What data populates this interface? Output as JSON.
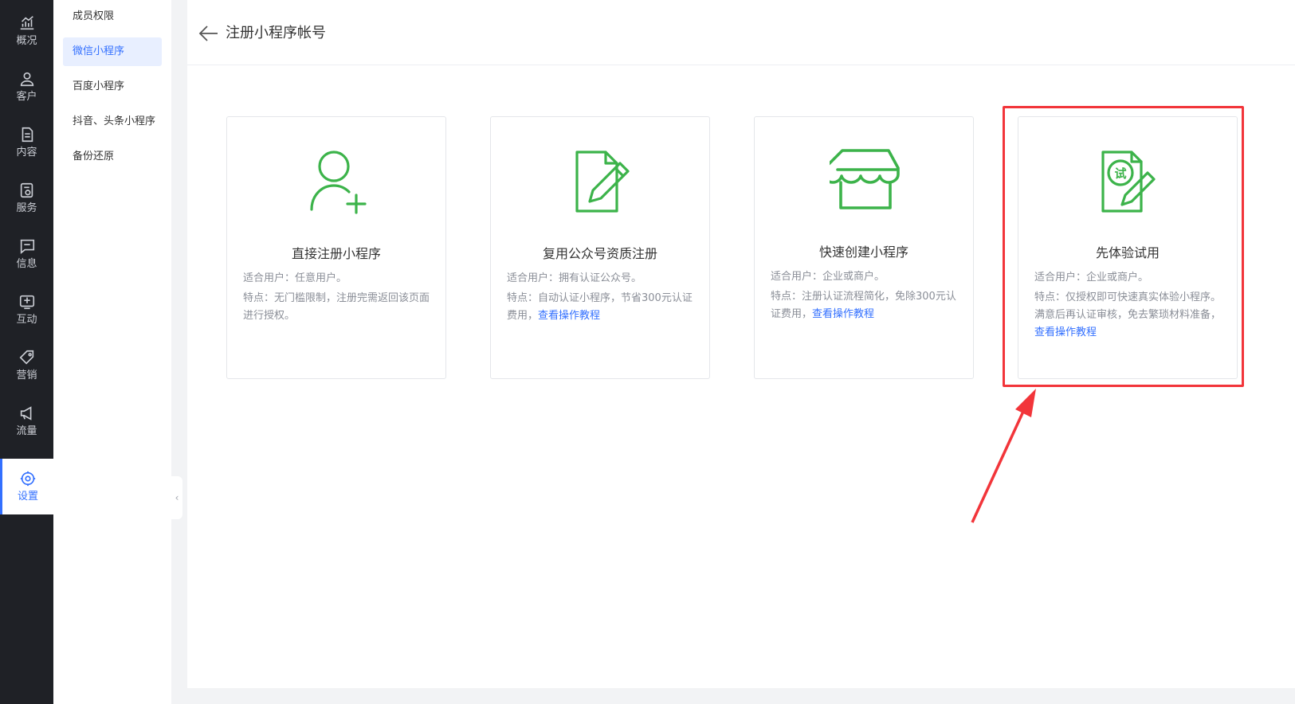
{
  "nav": {
    "items": [
      {
        "label": "概况",
        "icon": "chart-icon"
      },
      {
        "label": "客户",
        "icon": "user-icon"
      },
      {
        "label": "内容",
        "icon": "document-icon"
      },
      {
        "label": "服务",
        "icon": "service-icon"
      },
      {
        "label": "信息",
        "icon": "message-icon"
      },
      {
        "label": "互动",
        "icon": "interact-icon"
      },
      {
        "label": "营销",
        "icon": "tag-icon"
      },
      {
        "label": "流量",
        "icon": "megaphone-icon"
      },
      {
        "label": "设置",
        "icon": "gear-icon",
        "active": true
      }
    ]
  },
  "submenu": {
    "items": [
      {
        "label": "成员权限"
      },
      {
        "label": "微信小程序",
        "active": true
      },
      {
        "label": "百度小程序"
      },
      {
        "label": "抖音、头条小程序"
      },
      {
        "label": "备份还原"
      }
    ]
  },
  "collapse_glyph": "‹",
  "header": {
    "title": "注册小程序帐号"
  },
  "cards": [
    {
      "title": "直接注册小程序",
      "icon": "add-user-icon",
      "line1": "适合用户：任意用户。",
      "line2": "特点：无门槛限制，注册完需返回该页面进行授权。",
      "link": ""
    },
    {
      "title": "复用公众号资质注册",
      "icon": "edit-document-icon",
      "line1": "适合用户：拥有认证公众号。",
      "line2": "特点：自动认证小程序，节省300元认证费用，",
      "link": "查看操作教程"
    },
    {
      "title": "快速创建小程序",
      "icon": "store-icon",
      "line1": "适合用户：企业或商户。",
      "line2": "特点：注册认证流程简化，免除300元认证费用，",
      "link": "查看操作教程"
    },
    {
      "title": "先体验试用",
      "icon": "trial-document-icon",
      "icon_text": "试",
      "line1": "适合用户：企业或商户。",
      "line2": "特点：仅授权即可快速真实体验小程序。满意后再认证审核，免去繁琐材料准备，",
      "link": "查看操作教程"
    }
  ],
  "colors": {
    "accent": "#3370ff",
    "icon_green": "#3cb34a",
    "highlight": "#f2353a",
    "nav_bg": "#1f2126"
  }
}
